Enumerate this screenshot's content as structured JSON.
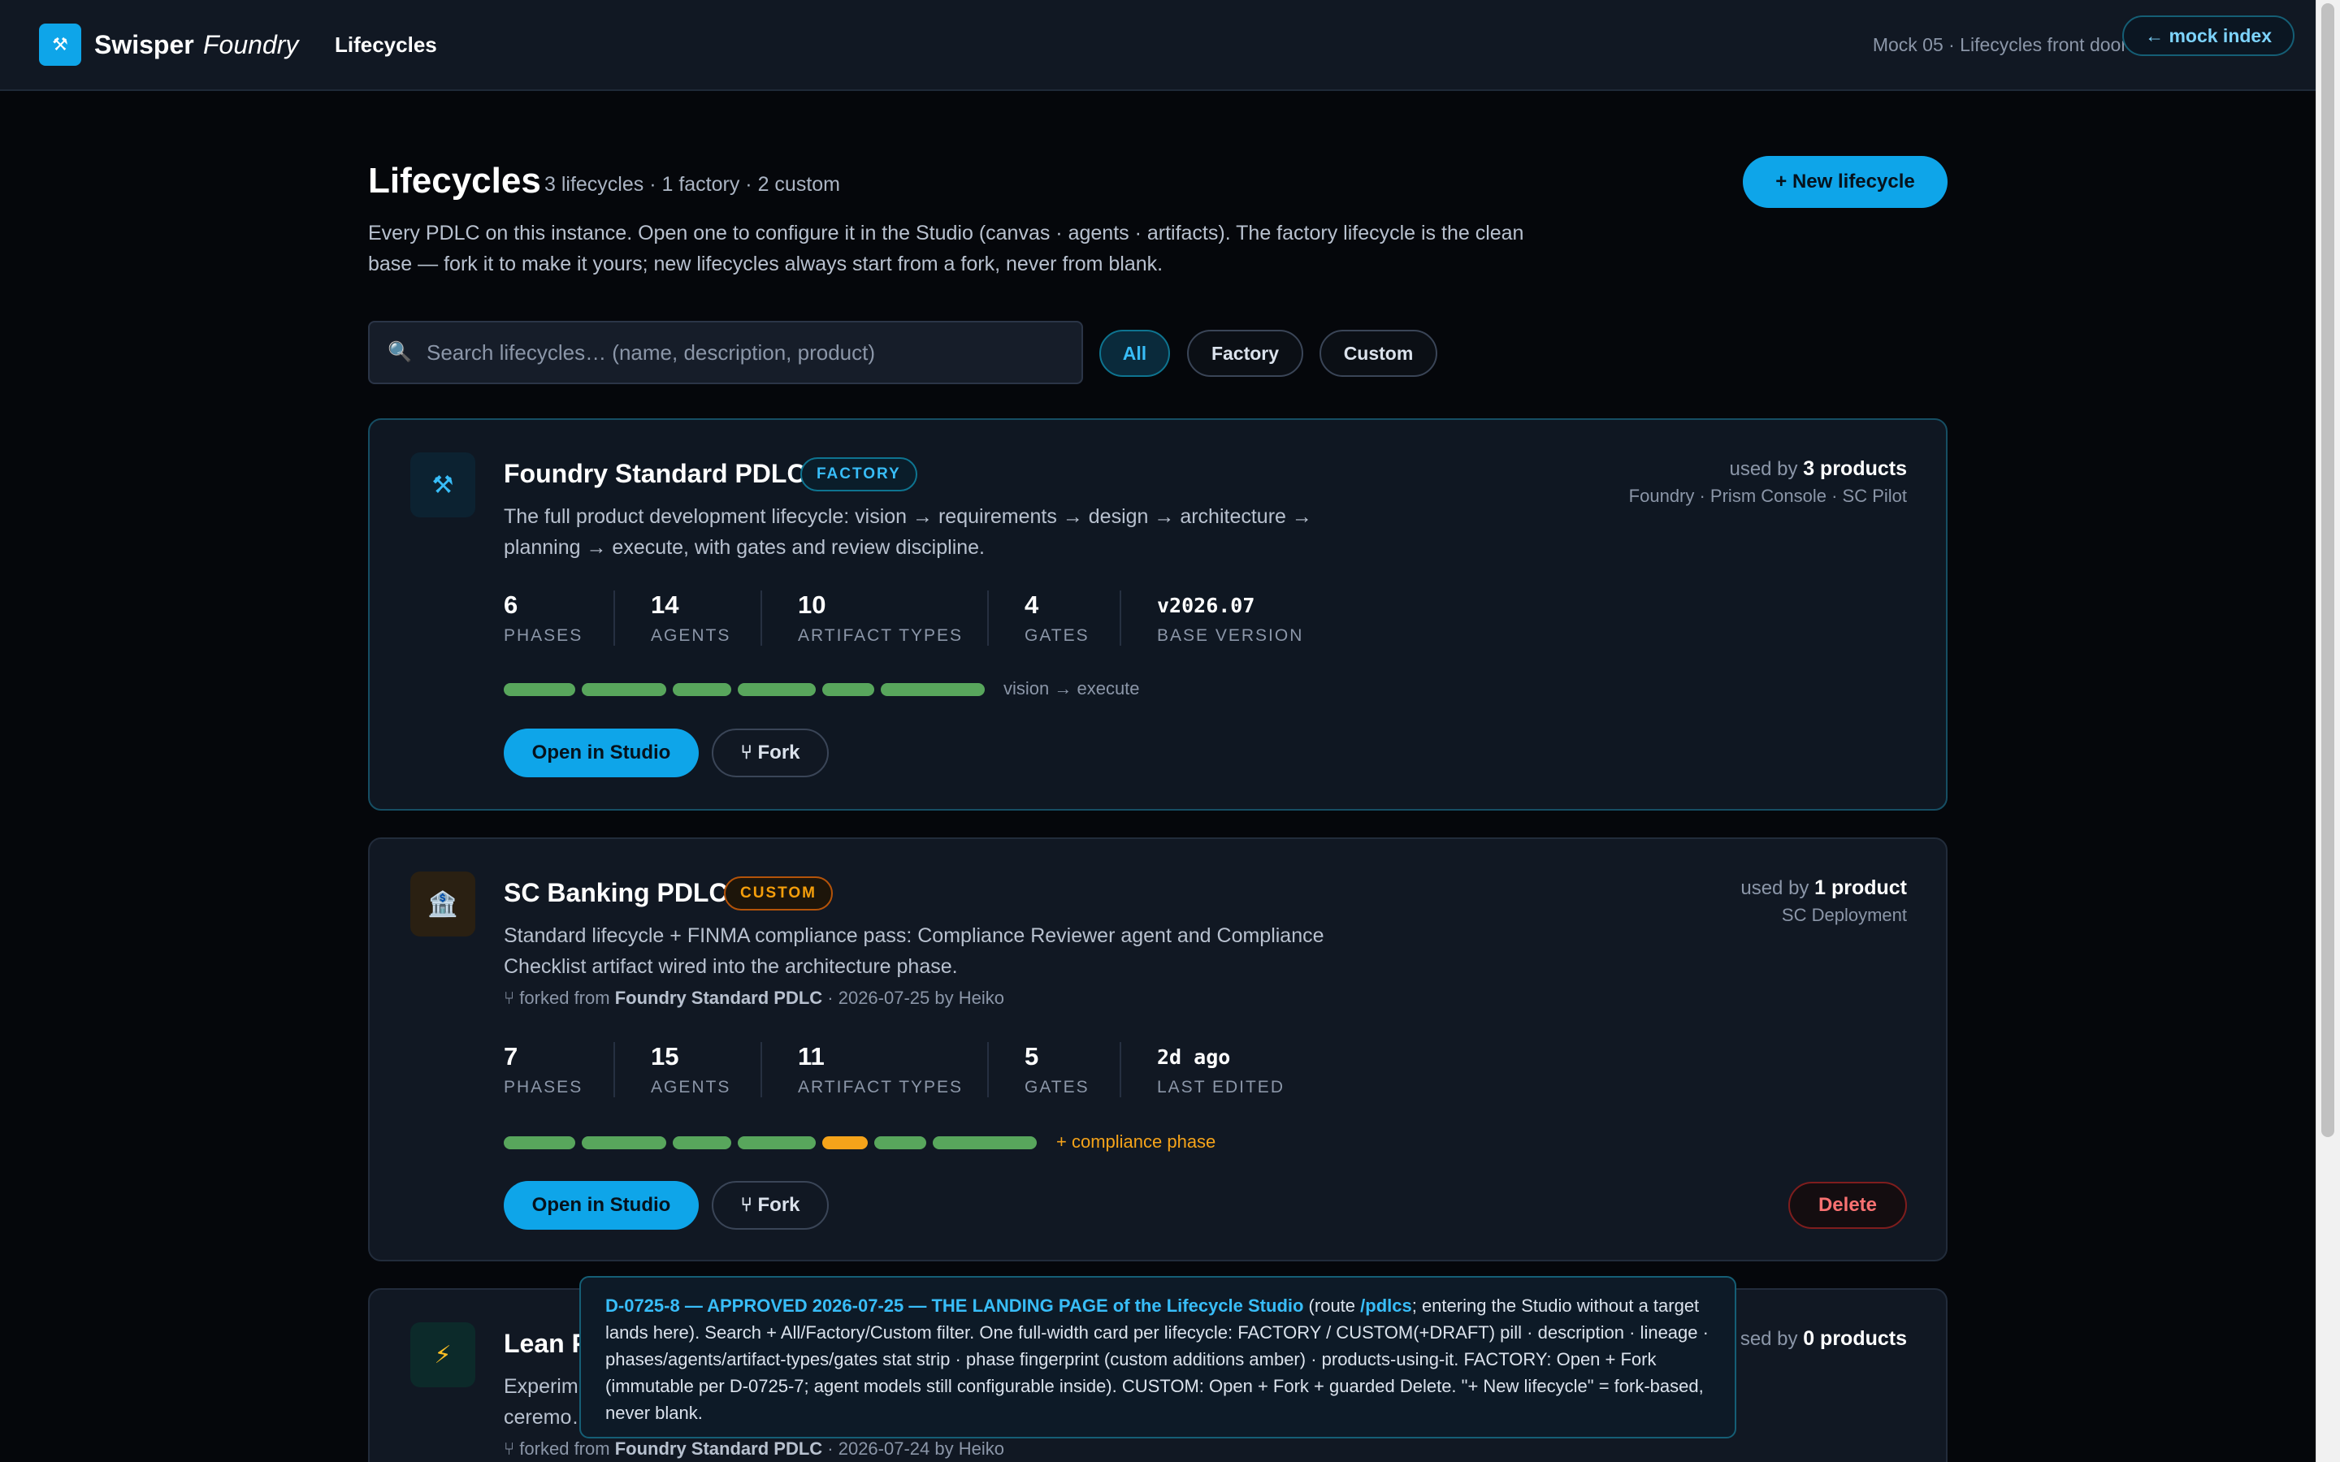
{
  "topbar": {
    "logo_glyph": "⚒",
    "brand": "Swisper",
    "brand_sub": "Foundry",
    "nav_title": "Lifecycles",
    "mock_label": "Mock 05 · Lifecycles front door",
    "mock_index_label": "← mock index"
  },
  "header": {
    "title": "Lifecycles",
    "counts": "3 lifecycles · 1 factory · 2 custom",
    "description": "Every PDLC on this instance. Open one to configure it in the Studio (canvas · agents · artifacts). The factory lifecycle is the clean base — fork it to make it yours; new lifecycles always start from a fork, never from blank.",
    "new_button": "+ New lifecycle"
  },
  "search": {
    "icon": "🔍",
    "placeholder": "Search lifecycles… (name, description, product)",
    "value": ""
  },
  "filters": [
    {
      "label": "All",
      "active": true
    },
    {
      "label": "Factory",
      "active": false
    },
    {
      "label": "Custom",
      "active": false
    }
  ],
  "colors": {
    "accent": "#0ea5e9",
    "phase_standard": "#58a65c",
    "phase_custom": "#f5a31a",
    "danger": "#f87171"
  },
  "cards": [
    {
      "icon": "⚒",
      "icon_name": "hammer-pick-icon",
      "title": "Foundry Standard PDLC",
      "badge": "FACTORY",
      "description": "The full product development lifecycle: vision → requirements → design → architecture → planning → execute, with gates and review discipline.",
      "used_by_prefix": "used by",
      "used_by_count": "3 products",
      "products": "Foundry · Prism Console · SC Pilot",
      "stats": [
        {
          "value": "6",
          "label": "PHASES"
        },
        {
          "value": "14",
          "label": "AGENTS"
        },
        {
          "value": "10",
          "label": "ARTIFACT TYPES"
        },
        {
          "value": "4",
          "label": "GATES"
        },
        {
          "value": "v2026.07",
          "label": "BASE VERSION"
        }
      ],
      "phases": [
        "standard",
        "standard",
        "standard",
        "standard",
        "standard",
        "standard"
      ],
      "fingerprint_label": "vision → execute",
      "open_label": "Open in Studio",
      "fork_label": "⑂ Fork"
    },
    {
      "icon": "🏦",
      "icon_name": "bank-icon",
      "title": "SC Banking PDLC",
      "badge": "CUSTOM",
      "description": "Standard lifecycle + FINMA compliance pass: Compliance Reviewer agent and Compliance Checklist artifact wired into the architecture phase.",
      "lineage_prefix": "⑂ forked from",
      "lineage_source": "Foundry Standard PDLC",
      "lineage_suffix": "· 2026-07-25 by Heiko",
      "used_by_prefix": "used by",
      "used_by_count": "1 product",
      "products": "SC Deployment",
      "stats": [
        {
          "value": "7",
          "label": "PHASES"
        },
        {
          "value": "15",
          "label": "AGENTS"
        },
        {
          "value": "11",
          "label": "ARTIFACT TYPES"
        },
        {
          "value": "5",
          "label": "GATES"
        },
        {
          "value": "2d ago",
          "label": "LAST EDITED"
        }
      ],
      "phases": [
        "standard",
        "standard",
        "standard",
        "standard",
        "custom",
        "standard",
        "standard"
      ],
      "fingerprint_label": "+ compliance phase",
      "open_label": "Open in Studio",
      "fork_label": "⑂ Fork",
      "delete_label": "Delete"
    },
    {
      "icon": "⚡",
      "icon_name": "lightning-icon",
      "title": "Lean P",
      "description": "Experim… ceremo…",
      "lineage_prefix": "⑂ forked from",
      "lineage_source": "Foundry Standard PDLC",
      "lineage_suffix": "· 2026-07-24 by Heiko",
      "used_by_prefix": "sed by",
      "used_by_count": "0 products"
    }
  ],
  "note": {
    "highlight_1": "D-0725-8 — APPROVED 2026-07-25 — THE LANDING PAGE of the Lifecycle Studio",
    "text_1": " (route ",
    "highlight_2": "/pdlcs",
    "text_2": "; entering the Studio without a target lands here). Search + All/Factory/Custom filter. One full-width card per lifecycle: FACTORY / CUSTOM(+DRAFT) pill · description · lineage · phases/agents/artifact-types/gates stat strip · phase fingerprint (custom additions amber) · products-using-it. FACTORY: Open + Fork (immutable per D-0725-7; agent models still configurable inside). CUSTOM: Open + Fork + guarded Delete. \"+ New lifecycle\" = fork-based, never blank."
  }
}
